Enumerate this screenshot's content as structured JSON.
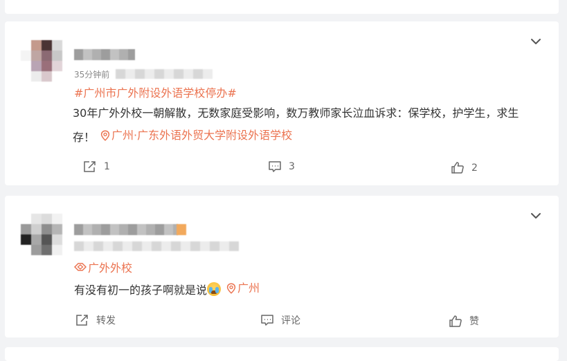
{
  "posts": [
    {
      "meta_text": "35分钟前",
      "topic": "#广州市广外附设外语学校停办#",
      "body": "30年广外外校一朝解散，无数家庭受影响，数万教师家长泣血诉求：保学校，护学生，求生存！",
      "location": "广州·广东外语外贸大学附设外语学校",
      "actions": {
        "share": "1",
        "comment": "3",
        "like": "2"
      }
    },
    {
      "topic": "广外外校",
      "body": "有没有初一的孩子啊就是说",
      "location": "广州",
      "actions": {
        "share": "转发",
        "comment": "评论",
        "like": "赞"
      }
    }
  ],
  "icons": {
    "chevron": "chevron-down-icon",
    "share": "share-icon",
    "comment": "comment-icon",
    "like": "thumbs-up-icon",
    "location": "location-pin-icon",
    "topic": "super-topic-icon",
    "emoji": "crying-emoji-icon"
  },
  "colors": {
    "accent": "#eb7350",
    "background": "#f2f3f5",
    "card": "#ffffff",
    "text": "#333333",
    "muted": "#666666"
  }
}
